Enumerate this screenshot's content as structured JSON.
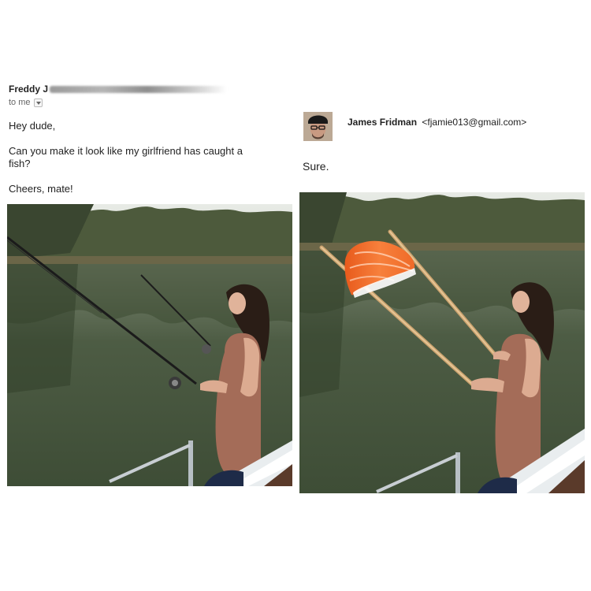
{
  "left": {
    "sender_name": "Freddy J",
    "to_me": "to me",
    "greeting": "Hey dude,",
    "body": "Can you make it look like my girlfriend has caught a fish?",
    "signoff": "Cheers, mate!"
  },
  "right": {
    "sender_name": "James Fridman",
    "sender_email": "<fjamie013@gmail.com>",
    "reply": "Sure."
  },
  "icons": [
    "chevron-down-icon",
    "avatar"
  ],
  "colors": {
    "water": "#4f5f46",
    "sky": "#dfe2dc",
    "dress": "#a46c58",
    "salmon": "#f26a24",
    "chopstick": "#d8b486"
  }
}
